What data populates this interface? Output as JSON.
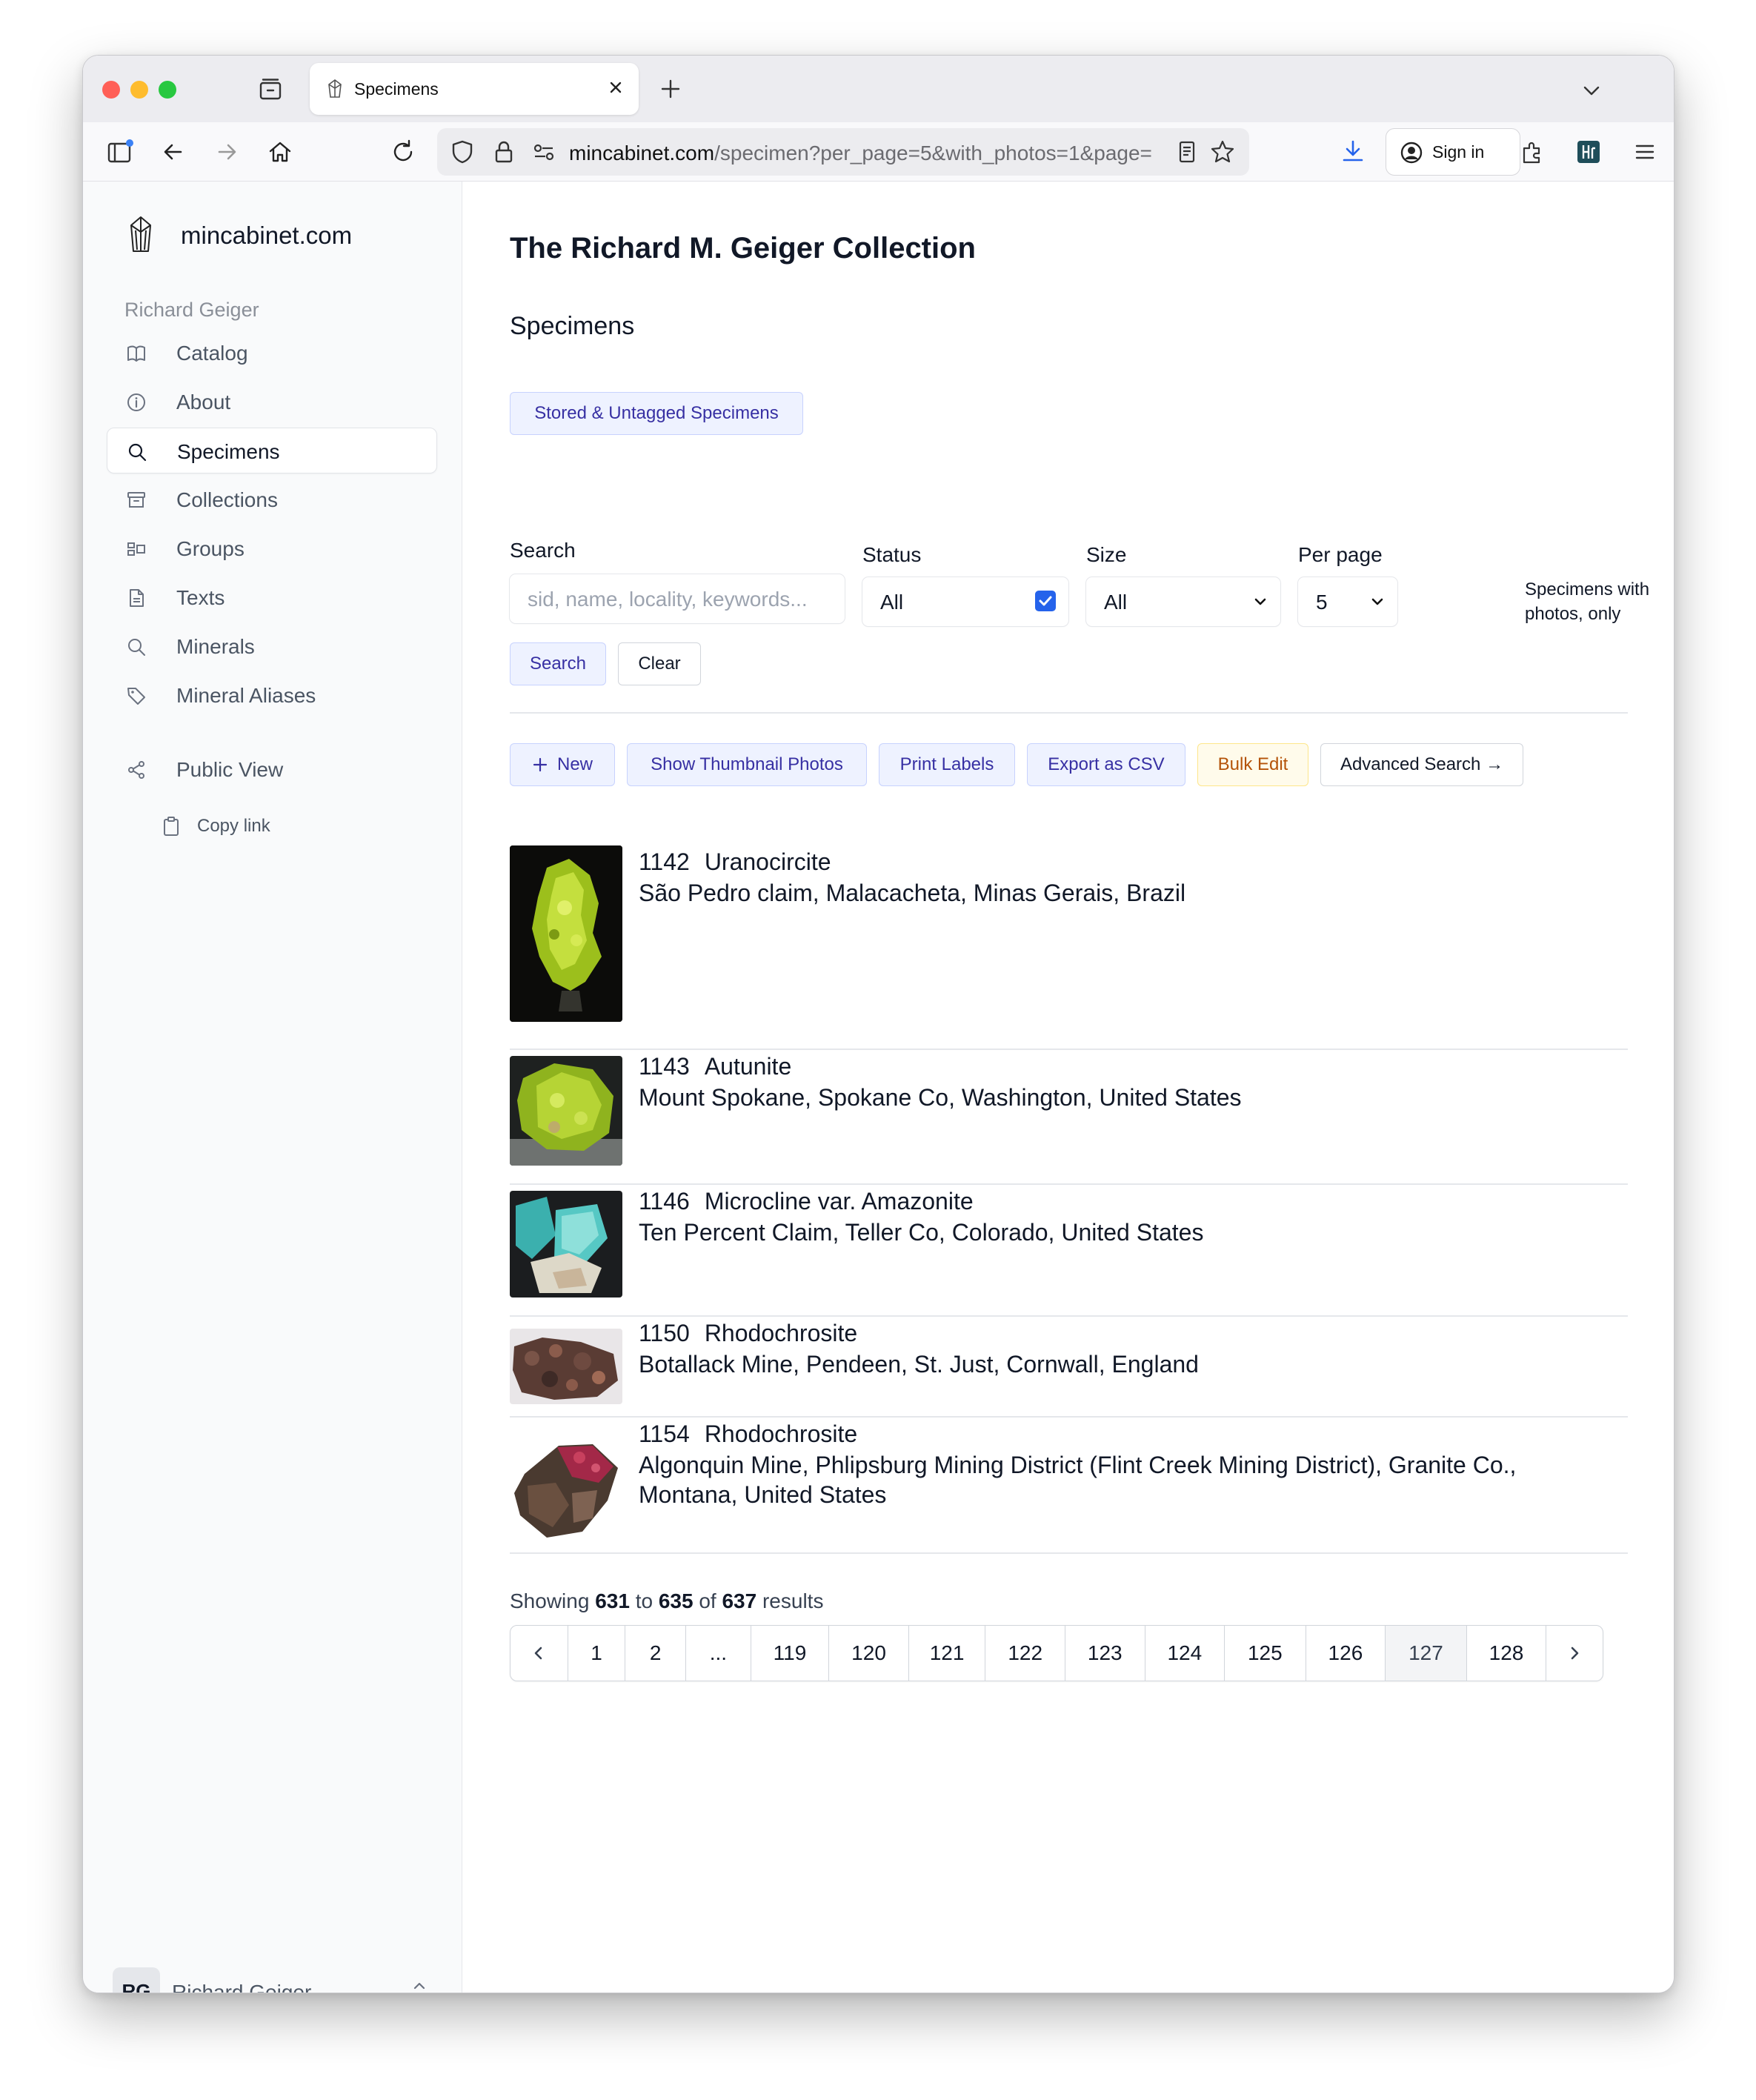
{
  "browser": {
    "tab_title": "Specimens",
    "url_host": "mincabinet.com",
    "url_path": "/specimen?per_page=5&with_photos=1&page=",
    "sign_in_label": "Sign in"
  },
  "sidebar": {
    "brand": "mincabinet.com",
    "owner": "Richard Geiger",
    "items": [
      {
        "label": "Catalog",
        "icon": "book-open-icon"
      },
      {
        "label": "About",
        "icon": "info-circle-icon"
      },
      {
        "label": "Specimens",
        "icon": "search-icon",
        "active": true
      },
      {
        "label": "Collections",
        "icon": "archive-box-icon"
      },
      {
        "label": "Groups",
        "icon": "groups-icon"
      },
      {
        "label": "Texts",
        "icon": "document-icon"
      },
      {
        "label": "Minerals",
        "icon": "search-icon"
      },
      {
        "label": "Mineral Aliases",
        "icon": "tag-icon"
      }
    ],
    "public_view": "Public View",
    "copy_link": "Copy link",
    "user_initials": "RG",
    "user_name": "Richard Geiger"
  },
  "main": {
    "title": "The Richard M. Geiger Collection",
    "section": "Specimens",
    "stored_button": "Stored & Untagged Specimens",
    "filters": {
      "search_label": "Search",
      "search_placeholder": "sid, name, locality, keywords...",
      "status_label": "Status",
      "status_value": "All",
      "size_label": "Size",
      "size_value": "All",
      "per_page_label": "Per page",
      "per_page_value": "5",
      "photos_only_label": "Specimens with photos, only",
      "photos_only_checked": true,
      "search_button": "Search",
      "clear_button": "Clear"
    },
    "actions": {
      "new": "New",
      "thumbnails": "Show Thumbnail Photos",
      "print_labels": "Print Labels",
      "export_csv": "Export as CSV",
      "bulk_edit": "Bulk Edit",
      "advanced_search": "Advanced Search →"
    },
    "specimens": [
      {
        "sid": "1142",
        "name": "Uranocircite",
        "locality": "São Pedro claim, Malacacheta, Minas Gerais, Brazil"
      },
      {
        "sid": "1143",
        "name": "Autunite",
        "locality": "Mount Spokane, Spokane Co, Washington, United States"
      },
      {
        "sid": "1146",
        "name": "Microcline var. Amazonite",
        "locality": "Ten Percent Claim, Teller Co, Colorado, United States"
      },
      {
        "sid": "1150",
        "name": "Rhodochrosite",
        "locality": "Botallack Mine, Pendeen, St. Just, Cornwall, England"
      },
      {
        "sid": "1154",
        "name": "Rhodochrosite",
        "locality": "Algonquin Mine, Phlipsburg Mining District (Flint Creek Mining District), Granite Co., Montana, United States"
      }
    ],
    "results": {
      "prefix": "Showing",
      "from": "631",
      "to_word": "to",
      "to": "635",
      "of_word": "of",
      "total": "637",
      "suffix": "results"
    },
    "pagination": [
      "1",
      "2",
      "...",
      "119",
      "120",
      "121",
      "122",
      "123",
      "124",
      "125",
      "126",
      "127",
      "128"
    ],
    "current_page": "127"
  }
}
